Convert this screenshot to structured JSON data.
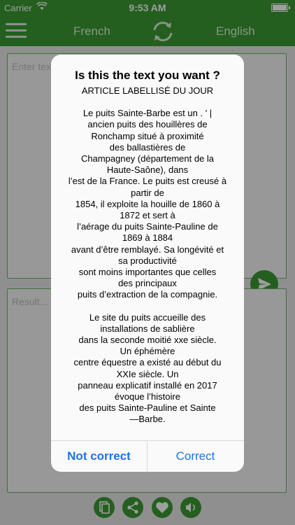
{
  "status_bar": {
    "carrier": "Carrier",
    "time": "9:53 AM"
  },
  "nav": {
    "source_lang": "French",
    "target_lang": "English"
  },
  "input": {
    "placeholder": "Enter text"
  },
  "result": {
    "placeholder": "Result..."
  },
  "alert": {
    "title": "Is this the text you want ?",
    "subtitle": "ARTICLE LABELLISÉ DU JOUR",
    "paragraph1": [
      "Le puits Sainte-Barbe est un  . ' |",
      "ancien puits des houillères de",
      "Ronchamp situé à proximité",
      "des ballastières de",
      "Champagney (département de la",
      "Haute-Saône), dans",
      "l’est de la France. Le puits est creusé à",
      "partir de",
      "1854, il exploite la houille de 1860 à",
      "1872 et sert à",
      "l’aérage du puits Sainte-Pauline de",
      "1869 à 1884",
      "avant d’être remblayé. Sa longévité et",
      "sa productivité",
      "sont moins importantes que celles",
      "des principaux",
      "puits d’extraction de la compagnie."
    ],
    "paragraph2": [
      "Le site du puits accueille des",
      "installations de sablière",
      "dans la seconde moitié xxe siècle.",
      "Un éphémère",
      "centre équestre a existé au début du",
      "XXIe siècle. Un",
      "panneau explicatif installé en 2017",
      "évoque l’histoire",
      "des puits Sainte-Pauline et Sainte",
      "—Barbe."
    ],
    "btn_not_correct": "Not correct",
    "btn_correct": "Correct"
  },
  "colors": {
    "primary": "#3a9a33",
    "link": "#1a73e8"
  }
}
